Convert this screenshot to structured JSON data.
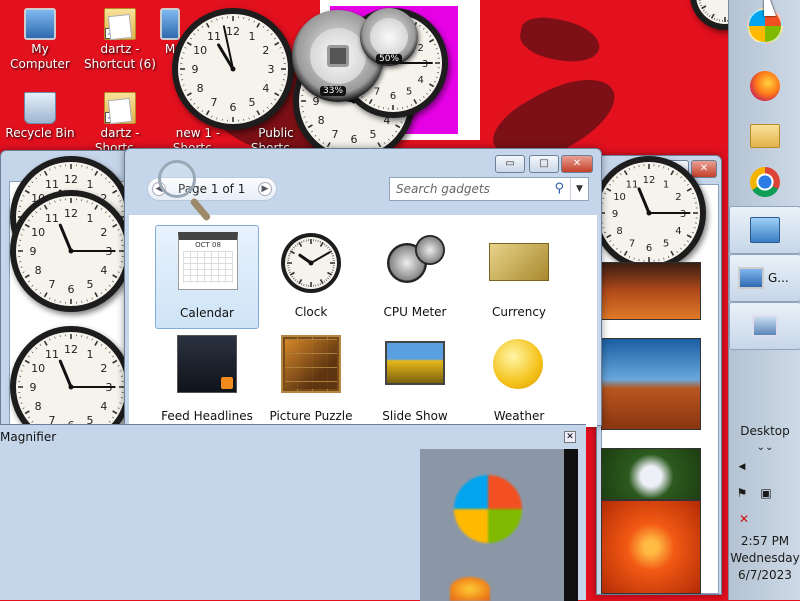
{
  "desktop": {
    "icons": [
      {
        "id": "my-computer",
        "label": "My Computer"
      },
      {
        "id": "dartz-6",
        "label": "dartz - Shortcut (6)"
      },
      {
        "id": "m-partial",
        "label": "M"
      },
      {
        "id": "recycle-bin",
        "label": "Recycle Bin"
      },
      {
        "id": "dartz-2",
        "label": "dartz - Shortc..."
      },
      {
        "id": "new1",
        "label": "new 1 - Shortc..."
      },
      {
        "id": "public",
        "label": "Public Shortc..."
      }
    ],
    "cpu_gauge_label": "33%",
    "mem_gauge_label": "50%"
  },
  "gallery": {
    "page_text": "Page 1 of 1",
    "search_placeholder": "Search gadgets",
    "gadgets": [
      {
        "label": "Calendar",
        "selected": true,
        "icon": "calendar-icon"
      },
      {
        "label": "Clock",
        "selected": false,
        "icon": "clock-icon"
      },
      {
        "label": "CPU Meter",
        "selected": false,
        "icon": "cpu-meter-icon"
      },
      {
        "label": "Currency",
        "selected": false,
        "icon": "currency-icon"
      },
      {
        "label": "Feed Headlines",
        "selected": false,
        "icon": "feed-icon"
      },
      {
        "label": "Picture Puzzle",
        "selected": false,
        "icon": "puzzle-icon"
      },
      {
        "label": "Slide Show",
        "selected": false,
        "icon": "slideshow-icon"
      },
      {
        "label": "Weather",
        "selected": false,
        "icon": "weather-icon"
      }
    ],
    "calendar_month": "OCT 08",
    "minimize_glyph": "▭",
    "maximize_glyph": "□",
    "close_glyph": "✕"
  },
  "magnifier": {
    "title": "Magnifier",
    "close_glyph": "✕"
  },
  "taskbar": {
    "window_label": "G...",
    "desktop_label": "Desktop",
    "desktop_chevron": "⌄⌄",
    "time": "2:57 PM",
    "day": "Wednesday",
    "date": "6/7/2023"
  },
  "colors": {
    "desktop_bg": "#e3101e",
    "accent_magenta": "#e600e6",
    "window_chrome": "#c6d6ea"
  }
}
